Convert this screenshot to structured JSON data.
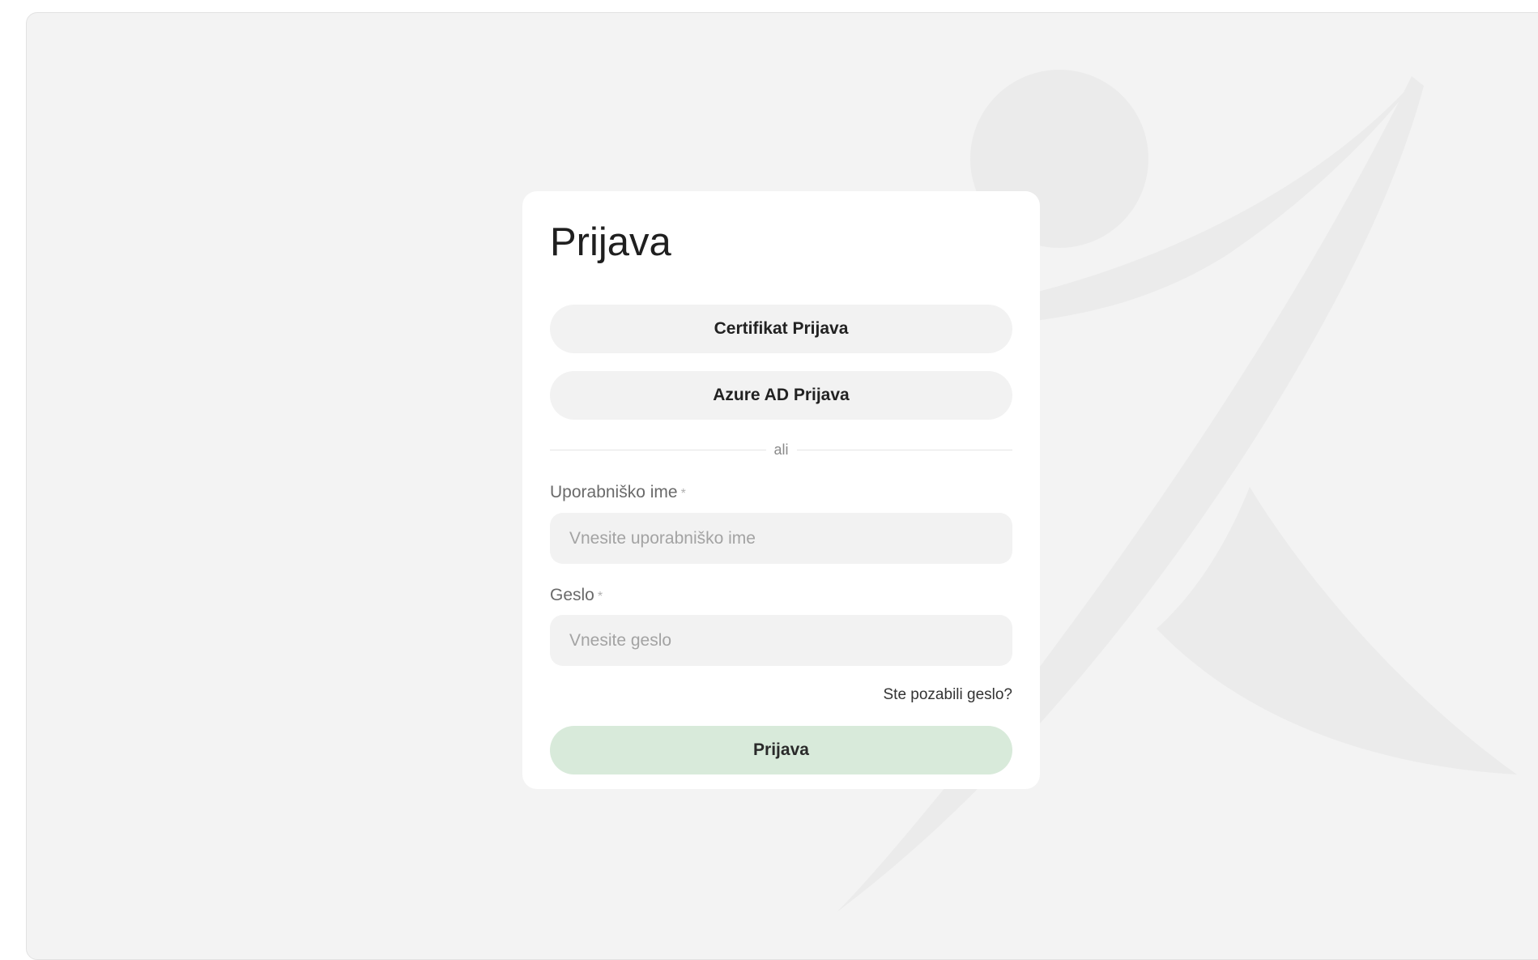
{
  "login": {
    "title": "Prijava",
    "certificate_button": "Certifikat Prijava",
    "azure_button": "Azure AD Prijava",
    "divider_text": "ali",
    "username": {
      "label": "Uporabniško ime",
      "required_marker": "*",
      "placeholder": "Vnesite uporabniško ime",
      "value": ""
    },
    "password": {
      "label": "Geslo",
      "required_marker": "*",
      "placeholder": "Vnesite geslo",
      "value": ""
    },
    "forgot_password": "Ste pozabili geslo?",
    "submit_button": "Prijava"
  },
  "colors": {
    "page_background": "#f3f3f3",
    "card_background": "#ffffff",
    "pill_background": "#f2f2f2",
    "submit_background": "#d8eada",
    "watermark": "#ebebeb"
  },
  "icons": {
    "background_watermark": "person-figure-logo"
  }
}
